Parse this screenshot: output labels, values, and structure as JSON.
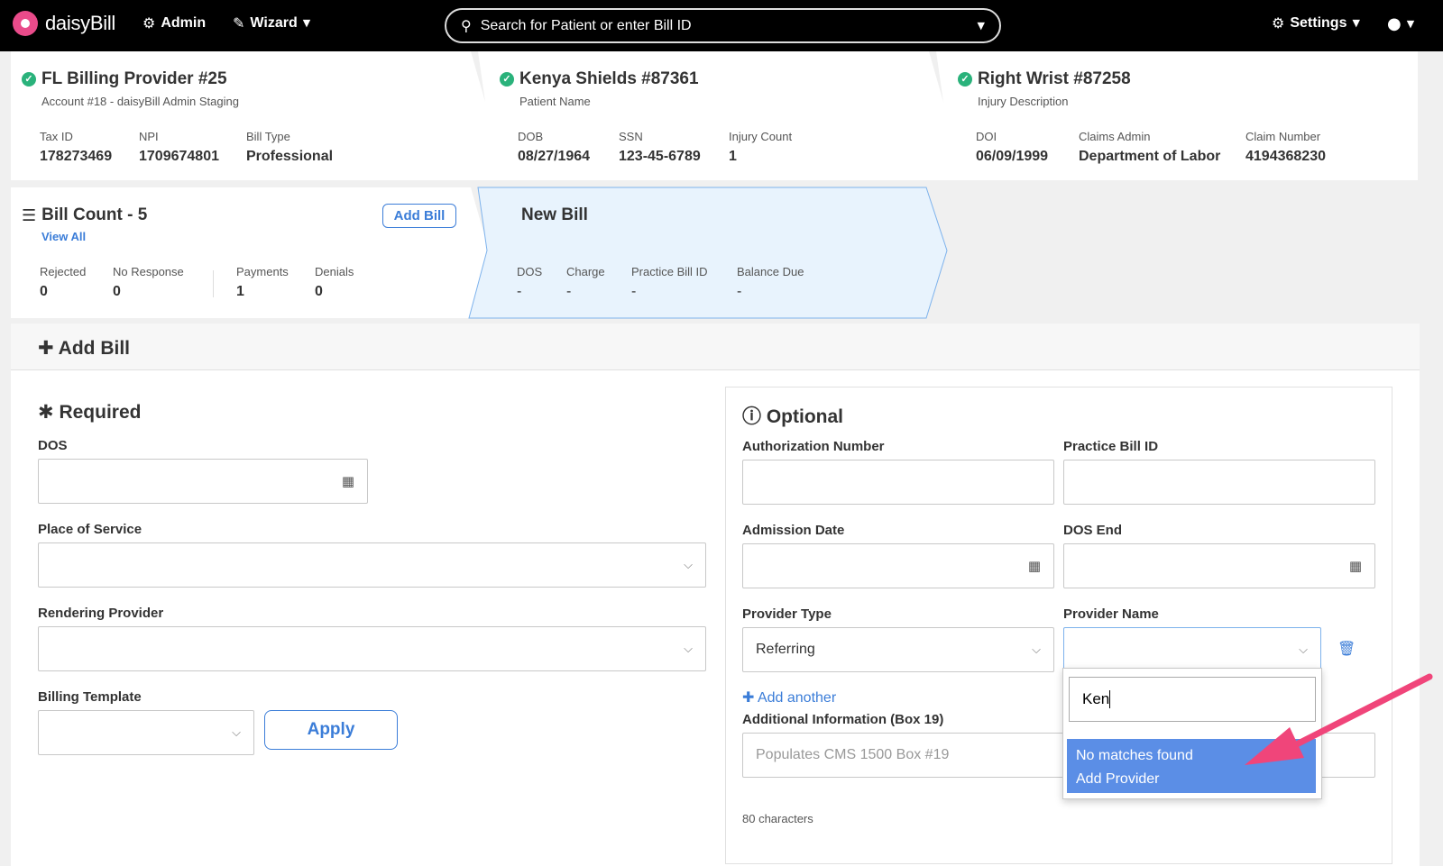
{
  "nav": {
    "brand": "daisyBill",
    "admin": "Admin",
    "wizard": "Wizard",
    "search_placeholder": "Search for Patient or enter Bill ID",
    "settings": "Settings"
  },
  "provider_card": {
    "title": "FL Billing Provider #25",
    "subtitle": "Account #18 - daisyBill Admin Staging",
    "fields": [
      {
        "label": "Tax ID",
        "value": "178273469"
      },
      {
        "label": "NPI",
        "value": "1709674801"
      },
      {
        "label": "Bill Type",
        "value": "Professional"
      }
    ]
  },
  "patient_card": {
    "title": "Kenya Shields #87361",
    "subtitle": "Patient Name",
    "fields": [
      {
        "label": "DOB",
        "value": "08/27/1964"
      },
      {
        "label": "SSN",
        "value": "123-45-6789"
      },
      {
        "label": "Injury Count",
        "value": "1"
      }
    ]
  },
  "injury_card": {
    "title": "Right Wrist #87258",
    "subtitle": "Injury Description",
    "fields": [
      {
        "label": "DOI",
        "value": "06/09/1999"
      },
      {
        "label": "Claims Admin",
        "value": "Department of Labor"
      },
      {
        "label": "Claim Number",
        "value": "4194368230"
      }
    ]
  },
  "bill_count_card": {
    "title": "Bill Count - 5",
    "view_all": "View All",
    "add_bill": "Add Bill",
    "fields": [
      {
        "label": "Rejected",
        "value": "0"
      },
      {
        "label": "No Response",
        "value": "0"
      },
      {
        "label": "Payments",
        "value": "1"
      },
      {
        "label": "Denials",
        "value": "0"
      }
    ]
  },
  "new_bill_card": {
    "title": "New Bill",
    "fields": [
      {
        "label": "DOS",
        "value": "-"
      },
      {
        "label": "Charge",
        "value": "-"
      },
      {
        "label": "Practice Bill ID",
        "value": "-"
      },
      {
        "label": "Balance Due",
        "value": "-"
      }
    ]
  },
  "form": {
    "title": "Add Bill",
    "required": {
      "title": "Required",
      "dos_label": "DOS",
      "place_of_service_label": "Place of Service",
      "rendering_provider_label": "Rendering Provider",
      "billing_template_label": "Billing Template",
      "apply": "Apply"
    },
    "optional": {
      "title": "Optional",
      "authorization_number_label": "Authorization Number",
      "practice_bill_id_label": "Practice Bill ID",
      "admission_date_label": "Admission Date",
      "dos_end_label": "DOS End",
      "provider_type_label": "Provider Type",
      "provider_type_value": "Referring",
      "provider_name_label": "Provider Name",
      "add_another": "Add another",
      "additional_info_label": "Additional Information (Box 19)",
      "additional_info_placeholder": "Populates CMS 1500 Box #19",
      "char_count": "80 characters"
    },
    "provider_dropdown": {
      "search_value": "Ken",
      "no_matches": "No matches found",
      "add_provider": "Add Provider"
    }
  },
  "colors": {
    "accent": "#3b7dd8",
    "success": "#2ab27b",
    "brand": "#e94b8a",
    "highlight": "#5b8ee6",
    "annotation_arrow": "#f0457a"
  }
}
